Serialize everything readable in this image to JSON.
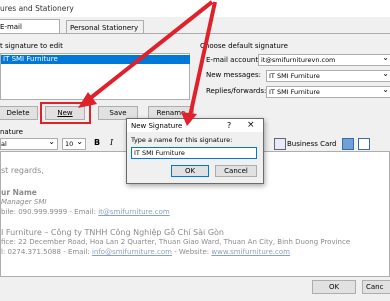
{
  "window": {
    "title": "ures and Stationery"
  },
  "tabs": [
    {
      "label": "E-mail Signature"
    },
    {
      "label": "Personal Stationery"
    }
  ],
  "select_signature": {
    "label": "t signature to edit",
    "items": [
      "IT SMI Furniture"
    ]
  },
  "buttons": {
    "delete": "Delete",
    "new": "New",
    "save": "Save",
    "rename": "Rename"
  },
  "defaults": {
    "header": "Choose default signature",
    "email_account_label": "E-mail account:",
    "email_account_value": "it@smifurniturevn.com",
    "new_messages_label": "New messages:",
    "new_messages_value": "IT SMI Furniture",
    "replies_label": "Replies/forwards:",
    "replies_value": "IT SMI Furniture"
  },
  "edit_signature": {
    "label": "nature",
    "font_name": "al",
    "font_size": "10",
    "bold_label": "B",
    "italic_label": "I",
    "business_card": "Business Card"
  },
  "signature": {
    "line1": "st regards,",
    "line2": "ur Name",
    "line3": " Manager SMI",
    "line4_prefix": "bile: 090.999.9999  -  Email: ",
    "line4_link": "it@smifurniture.com",
    "line5": "I Furniture – Công ty TNHH Công Nghiệp Gỗ Chí Sài Gòn",
    "line6": "fice: 22 December Road, Hoa Lan 2 Quarter, Thuan Giao Ward, Thuan An City, Binh Duong Province",
    "line7_prefix": "l: 0274.371.5088  -  Email: ",
    "line7_link1": "info@smifurniture.com",
    "line7_mid": "  -  Website: ",
    "line7_link2": "www.smifurniture.com"
  },
  "dialog": {
    "title": "New Signature",
    "help_icon": "?",
    "close_icon": "×",
    "prompt": "Type a name for this signature:",
    "value": "IT SMI Furniture",
    "ok": "OK",
    "cancel": "Cancel"
  },
  "footer": {
    "ok": "OK",
    "cancel": "Canc"
  },
  "colors": {
    "annotation": "#e0202a",
    "selection": "#0078d7"
  }
}
